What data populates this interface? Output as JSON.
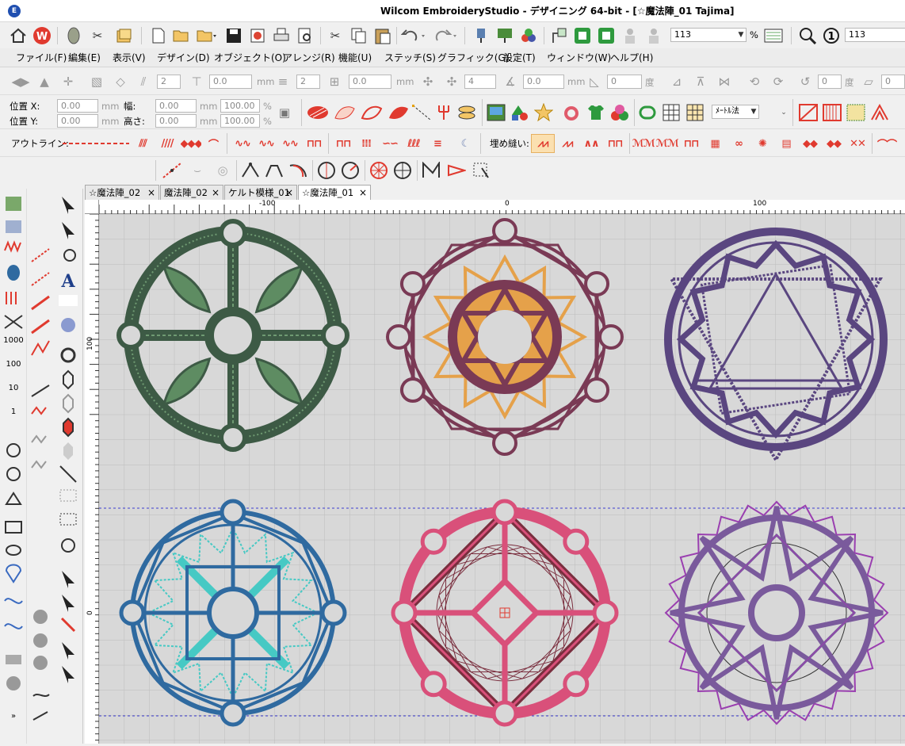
{
  "app": {
    "title": "Wilcom EmbroideryStudio - デザイニング 64-bit - [☆魔法陣_01       Tajima]",
    "icon_text": "E"
  },
  "toolbar1": {
    "zoom_value": "113",
    "zoom_unit": "%",
    "zoom_value2": "113"
  },
  "menu": [
    "ファイル(F)",
    "編集(E)",
    "表示(V)",
    "デザイン(D)",
    "オブジェクト(O)",
    "アレンジ(R)",
    "機能(U)",
    "ステッチ(S)",
    "グラフィック(G)",
    "設定(T)",
    "ウィンドウ(W)",
    "ヘルプ(H)"
  ],
  "toolbar3": {
    "mm1": "mm",
    "mm2": "mm",
    "mm3": "mm",
    "deg1": "度",
    "deg2": "度",
    "val_2a": "2",
    "val_0a": "0.0",
    "val_2b": "2",
    "val_0b": "0.0",
    "val_4": "4",
    "val_0c": "0.0",
    "val_0d": "0",
    "val_0e": "0",
    "val_0f": "0"
  },
  "props": {
    "pos_x_label": "位置 X:",
    "pos_y_label": "位置 Y:",
    "width_label": "幅:",
    "height_label": "高さ:",
    "pos_x": "0.00",
    "pos_y": "0.00",
    "width": "0.00",
    "height": "0.00",
    "pct_w": "100.00",
    "pct_h": "100.00",
    "unit": "mm",
    "pct": "%",
    "measure_select": "ﾒｰﾄﾙ法"
  },
  "stitchbar": {
    "outline_label": "アウトライン:",
    "fill_label": "埋め縫い:"
  },
  "tabs": [
    {
      "label": "☆魔法陣_02",
      "active": false
    },
    {
      "label": "魔法陣_02",
      "active": false
    },
    {
      "label": "ケルト模様_01",
      "active": false
    },
    {
      "label": "☆魔法陣_01",
      "active": true
    }
  ],
  "tab_close": "×",
  "ruler": {
    "h_labels": [
      "-100",
      "0",
      "100"
    ],
    "v_labels": [
      "100",
      "0"
    ]
  },
  "designs": [
    {
      "name": "magic-circle-green",
      "color": "#3d5a45",
      "accent": "#5e8c62"
    },
    {
      "name": "magic-circle-plum",
      "color": "#7a3a55",
      "accent": "#e5a14a"
    },
    {
      "name": "magic-circle-violet",
      "color": "#5a4680",
      "accent": "#8a76b0"
    },
    {
      "name": "magic-circle-blue",
      "color": "#2f6aa0",
      "accent": "#46c9c4"
    },
    {
      "name": "magic-circle-pink",
      "color": "#d9507a",
      "accent": "#7a2e3e"
    },
    {
      "name": "magic-circle-purple",
      "color": "#7a5a9c",
      "accent": "#9a3fb0"
    }
  ]
}
